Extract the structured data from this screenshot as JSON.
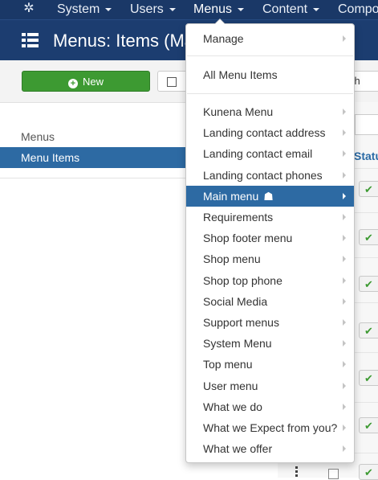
{
  "navbar": {
    "logo_icon": "joomla-logo-icon",
    "items": [
      {
        "label": "System"
      },
      {
        "label": "Users"
      },
      {
        "label": "Menus"
      },
      {
        "label": "Content"
      },
      {
        "label": "Compo"
      }
    ]
  },
  "header": {
    "icon": "list-icon",
    "title": "Menus: Items (Ma"
  },
  "toolbar": {
    "new_label": "New",
    "new_icon": "plus-circle-icon",
    "edit_icon": "edit-icon",
    "trash_label": "sh"
  },
  "sidebar": {
    "items": [
      {
        "label": "Menus"
      },
      {
        "label": "Menu Items"
      }
    ]
  },
  "list": {
    "status_header": "Statu"
  },
  "dropdown": {
    "top_items": [
      {
        "label": "Manage"
      },
      {
        "label": "All Menu Items"
      }
    ],
    "menus": [
      {
        "label": "Kunena Menu"
      },
      {
        "label": "Landing contact address"
      },
      {
        "label": "Landing contact email"
      },
      {
        "label": "Landing contact phones"
      },
      {
        "label": "Main menu"
      },
      {
        "label": "Requirements"
      },
      {
        "label": "Shop footer menu"
      },
      {
        "label": "Shop menu"
      },
      {
        "label": "Shop top phone"
      },
      {
        "label": "Social Media"
      },
      {
        "label": "Support menus"
      },
      {
        "label": "System Menu"
      },
      {
        "label": "Top menu"
      },
      {
        "label": "User menu"
      },
      {
        "label": "What we do"
      },
      {
        "label": "What we Expect from you?"
      },
      {
        "label": "What we offer"
      }
    ],
    "home_icon": "home-icon",
    "active_item": "Main menu"
  },
  "colors": {
    "navbar": "#1a3867",
    "header": "#1c3d70",
    "accent": "#2d6aa3",
    "success": "#3d9a32"
  }
}
